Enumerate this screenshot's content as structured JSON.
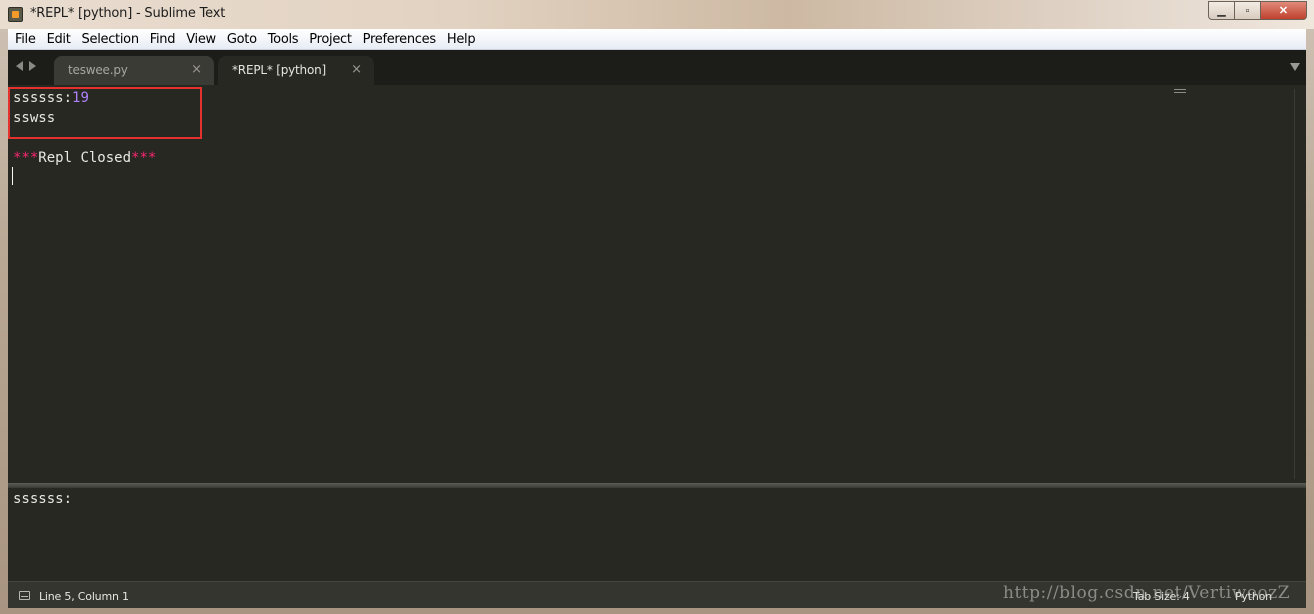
{
  "window": {
    "title": "*REPL* [python] - Sublime Text",
    "minimize_glyph": "▁",
    "maximize_glyph": "▫",
    "close_glyph": "✕"
  },
  "menu": {
    "items": [
      {
        "label": "File"
      },
      {
        "label": "Edit"
      },
      {
        "label": "Selection"
      },
      {
        "label": "Find"
      },
      {
        "label": "View"
      },
      {
        "label": "Goto"
      },
      {
        "label": "Tools"
      },
      {
        "label": "Project"
      },
      {
        "label": "Preferences"
      },
      {
        "label": "Help"
      }
    ]
  },
  "tabs": [
    {
      "label": "teswee.py",
      "close": "×",
      "active": false
    },
    {
      "label": "*REPL* [python]",
      "close": "×",
      "active": true
    }
  ],
  "editor": {
    "line1_prefix": "ssssss:",
    "line1_number": "19",
    "line2": "sswss",
    "line4_stars_left": "***",
    "line4_text": "Repl Closed",
    "line4_stars_right": "***"
  },
  "panel": {
    "text": "ssssss:"
  },
  "status": {
    "position": "Line 5, Column 1",
    "tab_size": "Tab Size: 4",
    "syntax": "Python"
  },
  "watermark": "http://blog.csdn.net/VertiwoozZ",
  "colors": {
    "editor_bg": "#272822",
    "number": "#ae81ff",
    "stars": "#f92672",
    "highlight_box": "#e4322e"
  }
}
